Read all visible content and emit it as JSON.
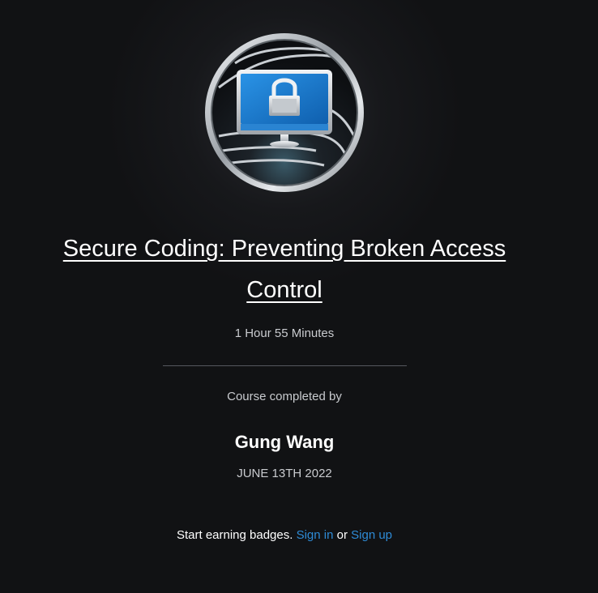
{
  "course": {
    "title": "Secure Coding: Preventing Broken Access Control",
    "duration": "1 Hour 55 Minutes",
    "badge_icon": "lock-monitor-icon"
  },
  "completion": {
    "label": "Course completed by",
    "user_name": "Gung Wang",
    "date": "JUNE 13TH 2022"
  },
  "footer": {
    "prompt": "Start earning badges.",
    "sign_in": "Sign in",
    "or": "or",
    "sign_up": "Sign up"
  },
  "colors": {
    "background": "#111214",
    "link": "#2e8bd6",
    "screen_blue": "#1b78c9"
  }
}
